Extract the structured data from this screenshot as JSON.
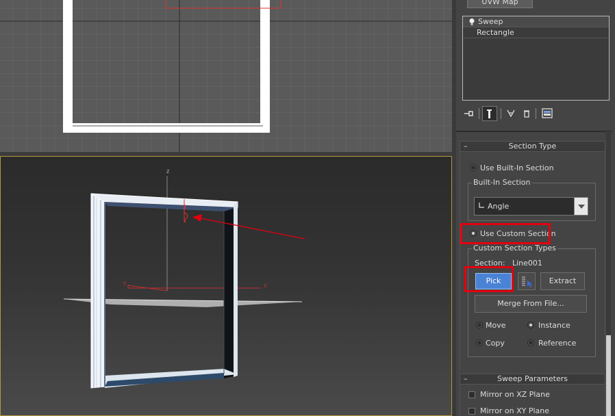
{
  "modifier_stack": {
    "top_button_label": "UVW Map",
    "items": [
      {
        "label": "Sweep",
        "icon": "lightbulb-icon"
      },
      {
        "label": "Rectangle"
      }
    ],
    "tool_icons": [
      "pin-stack-icon",
      "show-end-result-icon",
      "make-unique-icon",
      "remove-modifier-icon",
      "configure-modifier-sets-icon"
    ]
  },
  "section_type": {
    "title": "Section Type",
    "use_builtin_label": "Use Built-In Section",
    "builtin_group_title": "Built-In Section",
    "builtin_selected": "Angle",
    "use_custom_label": "Use Custom Section",
    "custom_group_title": "Custom Section Types",
    "section_label": "Section:",
    "section_value": "Line001",
    "pick_label": "Pick",
    "extract_label": "Extract",
    "merge_label": "Merge From File...",
    "move_label": "Move",
    "instance_label": "Instance",
    "copy_label": "Copy",
    "reference_label": "Reference"
  },
  "sweep_parameters": {
    "title": "Sweep Parameters",
    "mirror_xz_label": "Mirror on XZ Plane",
    "mirror_xy_label": "Mirror on XY Plane"
  },
  "viewport": {
    "axis_z": "z",
    "axis_y": "Y",
    "axis_x": "x"
  },
  "colors": {
    "highlight": "#e3000f",
    "pick_button": "#4a82d6",
    "viewport_border": "#b49a3a"
  }
}
